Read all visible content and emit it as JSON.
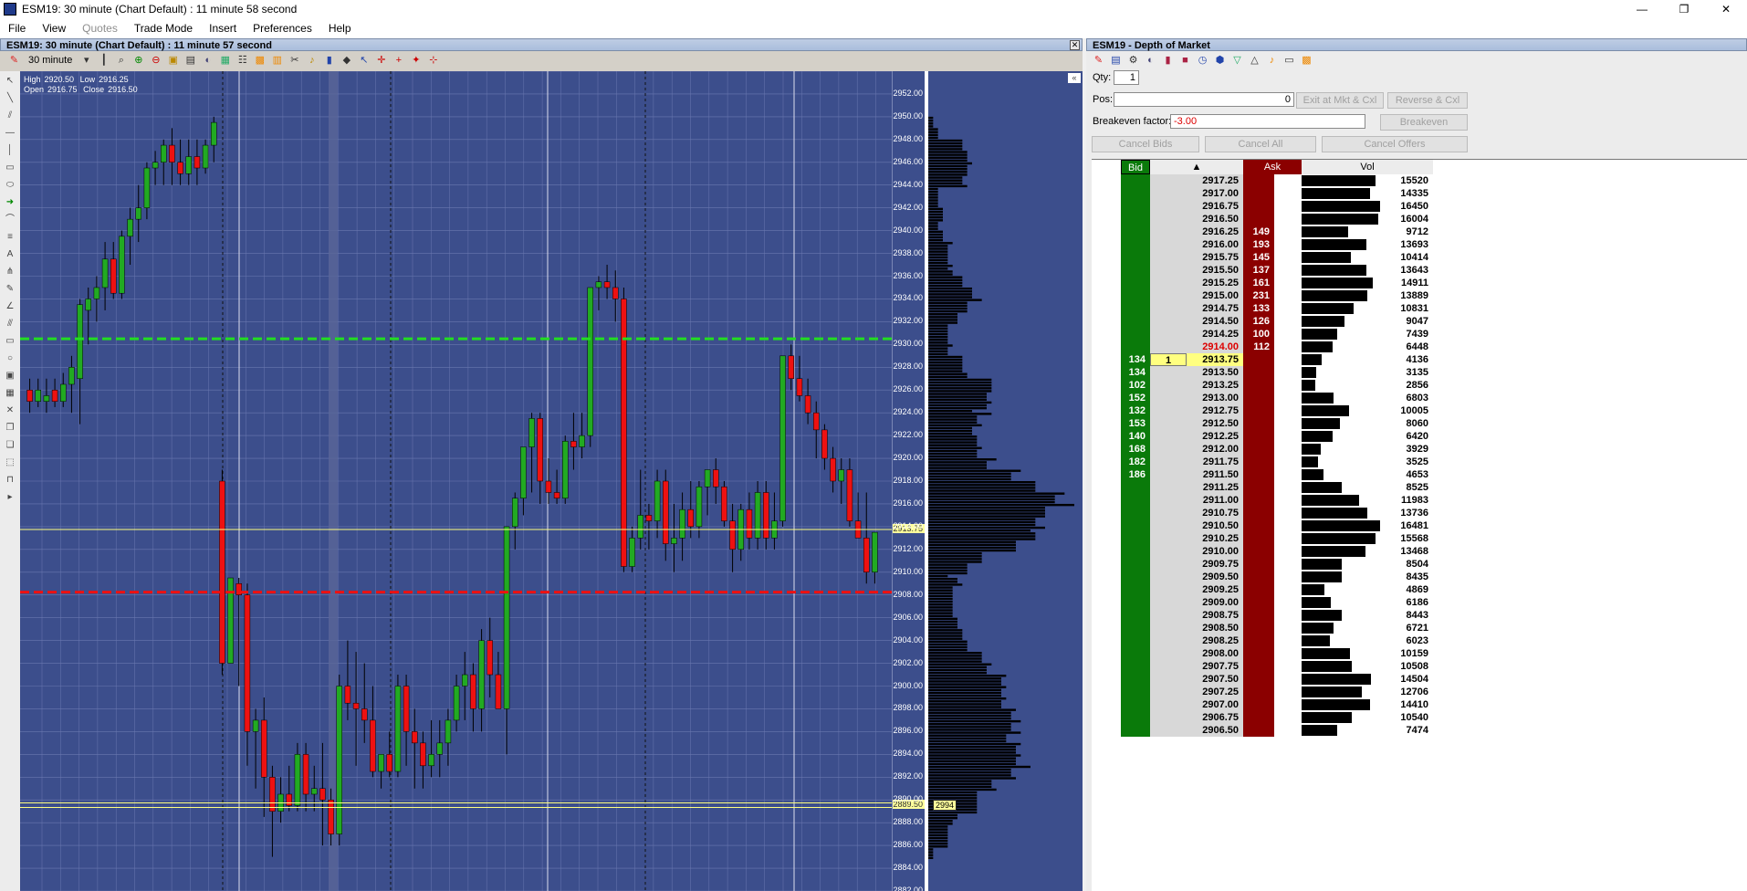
{
  "window": {
    "title": "ESM19: 30 minute (Chart Default) : 11 minute 58 second",
    "controls": [
      "—",
      "❐",
      "✕"
    ]
  },
  "menu": [
    {
      "label": "File",
      "enabled": true
    },
    {
      "label": "View",
      "enabled": true
    },
    {
      "label": "Quotes",
      "enabled": false
    },
    {
      "label": "Trade Mode",
      "enabled": true
    },
    {
      "label": "Insert",
      "enabled": true
    },
    {
      "label": "Preferences",
      "enabled": true
    },
    {
      "label": "Help",
      "enabled": true
    }
  ],
  "chart_window": {
    "title": "ESM19: 30 minute (Chart Default) : 11 minute 57 second",
    "interval": "30 minute"
  },
  "ohlc": {
    "high_label": "High",
    "high": "2920.50",
    "low_label": "Low",
    "low": "2916.25",
    "open_label": "Open",
    "open": "2916.75",
    "close_label": "Close",
    "close": "2916.50"
  },
  "chart_data": {
    "type": "candlestick",
    "instrument": "ESM19",
    "interval": "30 minute",
    "ylim": [
      2882,
      2954
    ],
    "yticks": [
      "2952.00",
      "2950.00",
      "2948.00",
      "2946.00",
      "2944.00",
      "2942.00",
      "2940.00",
      "2938.00",
      "2936.00",
      "2934.00",
      "2932.00",
      "2930.00",
      "2928.00",
      "2926.00",
      "2924.00",
      "2922.00",
      "2920.00",
      "2918.00",
      "2916.00",
      "2914.00",
      "2912.00",
      "2910.00",
      "2908.00",
      "2906.00",
      "2904.00",
      "2902.00",
      "2900.00",
      "2898.00",
      "2896.00",
      "2894.00",
      "2892.00",
      "2890.00",
      "2888.00",
      "2886.00",
      "2884.00",
      "2882.00"
    ],
    "candles": [
      [
        2926,
        2927,
        2924,
        2925
      ],
      [
        2925,
        2927,
        2924.5,
        2926
      ],
      [
        2925,
        2927,
        2924,
        2925.5
      ],
      [
        2926,
        2927,
        2924.5,
        2925
      ],
      [
        2925,
        2927.5,
        2924.5,
        2926.5
      ],
      [
        2926.5,
        2929,
        2924,
        2928
      ],
      [
        2927,
        2934,
        2923,
        2933.5
      ],
      [
        2933,
        2935,
        2930,
        2934
      ],
      [
        2934,
        2936,
        2932,
        2935
      ],
      [
        2935,
        2939,
        2933,
        2937.5
      ],
      [
        2937.5,
        2939,
        2934,
        2934.5
      ],
      [
        2934.5,
        2940,
        2934,
        2939.5
      ],
      [
        2939.5,
        2942,
        2937,
        2941
      ],
      [
        2941,
        2944,
        2939,
        2942
      ],
      [
        2942,
        2946,
        2941,
        2945.5
      ],
      [
        2945.5,
        2947,
        2944,
        2946
      ],
      [
        2946,
        2948,
        2944,
        2947.5
      ],
      [
        2947.5,
        2949,
        2944,
        2946
      ],
      [
        2946,
        2948,
        2944,
        2945
      ],
      [
        2945,
        2948,
        2944,
        2946.5
      ],
      [
        2946.5,
        2948,
        2944,
        2945.5
      ],
      [
        2945.5,
        2948,
        2945,
        2947.5
      ],
      [
        2947.5,
        2950,
        2946,
        2949.5
      ],
      [
        2918,
        2919,
        2901,
        2902
      ],
      [
        2902,
        2909.5,
        2902,
        2909.5
      ],
      [
        2909,
        2909.5,
        2900,
        2908
      ],
      [
        2908,
        2909,
        2893,
        2896
      ],
      [
        2896,
        2898,
        2891,
        2897
      ],
      [
        2897,
        2899,
        2888.5,
        2892
      ],
      [
        2892,
        2893,
        2885,
        2889
      ],
      [
        2889,
        2892,
        2888,
        2890.5
      ],
      [
        2890.5,
        2893,
        2889,
        2889.5
      ],
      [
        2889.5,
        2895,
        2889,
        2894
      ],
      [
        2894,
        2895,
        2889,
        2890.5
      ],
      [
        2890.5,
        2893,
        2889,
        2891
      ],
      [
        2891,
        2895,
        2886,
        2890
      ],
      [
        2890,
        2891,
        2886,
        2887
      ],
      [
        2887,
        2901,
        2886,
        2900
      ],
      [
        2900,
        2904,
        2897,
        2898.5
      ],
      [
        2898.5,
        2903,
        2893,
        2898
      ],
      [
        2898,
        2902,
        2895,
        2897
      ],
      [
        2897,
        2900,
        2892,
        2892.5
      ],
      [
        2892.5,
        2894,
        2891,
        2894
      ],
      [
        2894,
        2896,
        2892,
        2892.5
      ],
      [
        2892.5,
        2901,
        2892,
        2900
      ],
      [
        2900,
        2901,
        2893,
        2896
      ],
      [
        2896,
        2898,
        2891,
        2895
      ],
      [
        2895,
        2896,
        2891,
        2893
      ],
      [
        2893,
        2897,
        2892,
        2894
      ],
      [
        2894,
        2897,
        2892,
        2895
      ],
      [
        2895,
        2898,
        2893,
        2897
      ],
      [
        2897,
        2901,
        2896,
        2900
      ],
      [
        2900,
        2903,
        2897,
        2901
      ],
      [
        2901,
        2902,
        2896,
        2898
      ],
      [
        2898,
        2905,
        2896,
        2904
      ],
      [
        2904,
        2906,
        2899,
        2901
      ],
      [
        2901,
        2903,
        2898,
        2898
      ],
      [
        2898,
        2914,
        2894,
        2914
      ],
      [
        2914,
        2917,
        2912,
        2916.5
      ],
      [
        2916.5,
        2919,
        2915,
        2921
      ],
      [
        2921,
        2924,
        2917,
        2923.5
      ],
      [
        2923.5,
        2924,
        2916,
        2918
      ],
      [
        2918,
        2920,
        2916,
        2917
      ],
      [
        2917,
        2919,
        2916,
        2916.5
      ],
      [
        2916.5,
        2922,
        2916,
        2921.5
      ],
      [
        2921.5,
        2924,
        2919,
        2921
      ],
      [
        2921,
        2924,
        2920,
        2922
      ],
      [
        2922,
        2934,
        2921,
        2935
      ],
      [
        2935,
        2936,
        2933,
        2935.5
      ],
      [
        2935.5,
        2937,
        2934,
        2935
      ],
      [
        2935,
        2936.5,
        2932,
        2934
      ],
      [
        2934,
        2935,
        2910,
        2910.5
      ],
      [
        2910.5,
        2914,
        2910,
        2913
      ],
      [
        2913,
        2919,
        2912,
        2915
      ],
      [
        2915,
        2916,
        2912,
        2914.5
      ],
      [
        2914.5,
        2919,
        2913,
        2918
      ],
      [
        2918,
        2919,
        2911,
        2912.5
      ],
      [
        2912.5,
        2916,
        2910,
        2913
      ],
      [
        2913,
        2917,
        2911,
        2915.5
      ],
      [
        2915.5,
        2918,
        2913,
        2914
      ],
      [
        2914,
        2918,
        2913,
        2917.5
      ],
      [
        2917.5,
        2919,
        2915,
        2919
      ],
      [
        2919,
        2920,
        2916,
        2917.5
      ],
      [
        2917.5,
        2918,
        2914,
        2914.5
      ],
      [
        2914.5,
        2916,
        2910,
        2912
      ],
      [
        2912,
        2916,
        2911,
        2915.5
      ],
      [
        2915.5,
        2917,
        2912,
        2913
      ],
      [
        2913,
        2918,
        2912,
        2917
      ],
      [
        2917,
        2918,
        2912,
        2913
      ],
      [
        2913,
        2917,
        2912,
        2914.5
      ],
      [
        2914.5,
        2929,
        2914,
        2929
      ],
      [
        2929,
        2930,
        2926,
        2927
      ],
      [
        2927,
        2929,
        2925,
        2925.5
      ],
      [
        2925.5,
        2927,
        2923,
        2924
      ],
      [
        2924,
        2925,
        2920,
        2922.5
      ],
      [
        2922.5,
        2923,
        2919,
        2920
      ],
      [
        2920,
        2921,
        2917,
        2918
      ],
      [
        2918,
        2920,
        2916,
        2919
      ],
      [
        2919,
        2920,
        2914,
        2914.5
      ],
      [
        2914.5,
        2917,
        2913,
        2913
      ],
      [
        2913,
        2917,
        2909,
        2910
      ],
      [
        2910,
        2913.5,
        2909,
        2913.5
      ]
    ],
    "annotations": {
      "resistance": 2930.5,
      "support": 2908.25,
      "last": 2913.75,
      "poc": 2889.5,
      "last_label": "2913.75",
      "poc_label": "2889.50",
      "poc_volume": "2994"
    }
  },
  "dom": {
    "title": "ESM19 - Depth of Market",
    "qty_label": "Qty:",
    "qty": "1",
    "pos_label": "Pos:",
    "pos": "0",
    "breakeven_label": "Breakeven factor:",
    "breakeven": "-3.00",
    "exit_button": "Exit at Mkt & Cxl",
    "reverse_button": "Reverse & Cxl",
    "breakeven_button": "Breakeven",
    "cancel_bids": "Cancel Bids",
    "cancel_all": "Cancel All",
    "cancel_offers": "Cancel Offers",
    "headers": {
      "bid": "Bid",
      "price": "▲",
      "ask": "Ask",
      "vol": "Vol"
    },
    "rows": [
      {
        "price": "2917.25",
        "bid": "",
        "ask": "",
        "vol": "15520"
      },
      {
        "price": "2917.00",
        "bid": "",
        "ask": "",
        "vol": "14335"
      },
      {
        "price": "2916.75",
        "bid": "",
        "ask": "",
        "vol": "16450"
      },
      {
        "price": "2916.50",
        "bid": "",
        "ask": "",
        "vol": "16004"
      },
      {
        "price": "2916.25",
        "bid": "",
        "ask": "149",
        "vol": "9712"
      },
      {
        "price": "2916.00",
        "bid": "",
        "ask": "193",
        "vol": "13693"
      },
      {
        "price": "2915.75",
        "bid": "",
        "ask": "145",
        "vol": "10414"
      },
      {
        "price": "2915.50",
        "bid": "",
        "ask": "137",
        "vol": "13643"
      },
      {
        "price": "2915.25",
        "bid": "",
        "ask": "161",
        "vol": "14911"
      },
      {
        "price": "2915.00",
        "bid": "",
        "ask": "231",
        "vol": "13889"
      },
      {
        "price": "2914.75",
        "bid": "",
        "ask": "133",
        "vol": "10831"
      },
      {
        "price": "2914.50",
        "bid": "",
        "ask": "126",
        "vol": "9047"
      },
      {
        "price": "2914.25",
        "bid": "",
        "ask": "100",
        "vol": "7439"
      },
      {
        "price": "2914.00",
        "bid": "",
        "ask": "112",
        "vol": "6448",
        "best_ask": true
      },
      {
        "price": "2913.75",
        "bid": "134",
        "ask": "",
        "vol": "4136",
        "last": true,
        "working": "1"
      },
      {
        "price": "2913.50",
        "bid": "134",
        "ask": "",
        "vol": "3135"
      },
      {
        "price": "2913.25",
        "bid": "102",
        "ask": "",
        "vol": "2856"
      },
      {
        "price": "2913.00",
        "bid": "152",
        "ask": "",
        "vol": "6803"
      },
      {
        "price": "2912.75",
        "bid": "132",
        "ask": "",
        "vol": "10005"
      },
      {
        "price": "2912.50",
        "bid": "153",
        "ask": "",
        "vol": "8060"
      },
      {
        "price": "2912.25",
        "bid": "140",
        "ask": "",
        "vol": "6420"
      },
      {
        "price": "2912.00",
        "bid": "168",
        "ask": "",
        "vol": "3929"
      },
      {
        "price": "2911.75",
        "bid": "182",
        "ask": "",
        "vol": "3525"
      },
      {
        "price": "2911.50",
        "bid": "186",
        "ask": "",
        "vol": "4653"
      },
      {
        "price": "2911.25",
        "bid": "",
        "ask": "",
        "vol": "8525"
      },
      {
        "price": "2911.00",
        "bid": "",
        "ask": "",
        "vol": "11983"
      },
      {
        "price": "2910.75",
        "bid": "",
        "ask": "",
        "vol": "13736"
      },
      {
        "price": "2910.50",
        "bid": "",
        "ask": "",
        "vol": "16481"
      },
      {
        "price": "2910.25",
        "bid": "",
        "ask": "",
        "vol": "15568"
      },
      {
        "price": "2910.00",
        "bid": "",
        "ask": "",
        "vol": "13468"
      },
      {
        "price": "2909.75",
        "bid": "",
        "ask": "",
        "vol": "8504"
      },
      {
        "price": "2909.50",
        "bid": "",
        "ask": "",
        "vol": "8435"
      },
      {
        "price": "2909.25",
        "bid": "",
        "ask": "",
        "vol": "4869"
      },
      {
        "price": "2909.00",
        "bid": "",
        "ask": "",
        "vol": "6186"
      },
      {
        "price": "2908.75",
        "bid": "",
        "ask": "",
        "vol": "8443"
      },
      {
        "price": "2908.50",
        "bid": "",
        "ask": "",
        "vol": "6721"
      },
      {
        "price": "2908.25",
        "bid": "",
        "ask": "",
        "vol": "6023"
      },
      {
        "price": "2908.00",
        "bid": "",
        "ask": "",
        "vol": "10159"
      },
      {
        "price": "2907.75",
        "bid": "",
        "ask": "",
        "vol": "10508"
      },
      {
        "price": "2907.50",
        "bid": "",
        "ask": "",
        "vol": "14504"
      },
      {
        "price": "2907.25",
        "bid": "",
        "ask": "",
        "vol": "12706"
      },
      {
        "price": "2907.00",
        "bid": "",
        "ask": "",
        "vol": "14410"
      },
      {
        "price": "2906.75",
        "bid": "",
        "ask": "",
        "vol": "10540"
      },
      {
        "price": "2906.50",
        "bid": "",
        "ask": "",
        "vol": "7474"
      }
    ]
  },
  "colors": {
    "chart_bg": "#3c4e8c",
    "grid": "#6a78b0",
    "bull": "#22aa22",
    "bear": "#ee1111",
    "resistance": "#22dd22",
    "support": "#ee1111",
    "bid_col": "#0a7a0a",
    "ask_col": "#8b0000",
    "last_price": "#ffff80"
  }
}
